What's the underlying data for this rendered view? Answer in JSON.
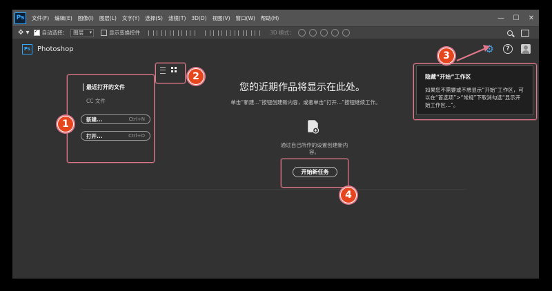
{
  "app": {
    "logo": "Ps",
    "menu": [
      "文件(F)",
      "编辑(E)",
      "图像(I)",
      "图层(L)",
      "文字(Y)",
      "选择(S)",
      "滤镜(T)",
      "3D(D)",
      "视图(V)",
      "窗口(W)",
      "帮助(H)"
    ],
    "window_controls": {
      "minimize": "—",
      "maximize": "☐",
      "close": "✕"
    }
  },
  "options_bar": {
    "auto_select_label": "自动选择：",
    "auto_select_value": "图层",
    "show_transform_label": "显示变换控件",
    "mode_3d_label": "3D 模式："
  },
  "start_header": {
    "logo": "Ps",
    "app_name": "Photoshop",
    "gear_glyph": "⚙",
    "help_glyph": "?"
  },
  "left_panel": {
    "recent_title": "最近打开的文件",
    "cc_files": "CC 文件",
    "new_label": "新建...",
    "new_shortcut": "Ctrl+N",
    "open_label": "打开...",
    "open_shortcut": "Ctrl+O"
  },
  "center": {
    "title": "您的近期作品将显示在此处。",
    "subtitle": "单击“新建...”按钮创建新内容，或者单击“打开...”按钮继续工作。",
    "new_doc_desc": "通过自己所作的设置创建新内容。",
    "start_button": "开始新任务"
  },
  "tooltip": {
    "title": "隐藏“开始”工作区",
    "body": "如果您不需要或不想显示“开始”工作区，可以在“首选项”>“常规”下取消勾选“显示开始工作区...”。"
  },
  "annotations": [
    "1",
    "2",
    "3",
    "4"
  ],
  "colors": {
    "accent_blue": "#31a8ff",
    "annotation_red": "#e6461e",
    "annotation_pink": "#e0788a",
    "background": "#323232"
  }
}
